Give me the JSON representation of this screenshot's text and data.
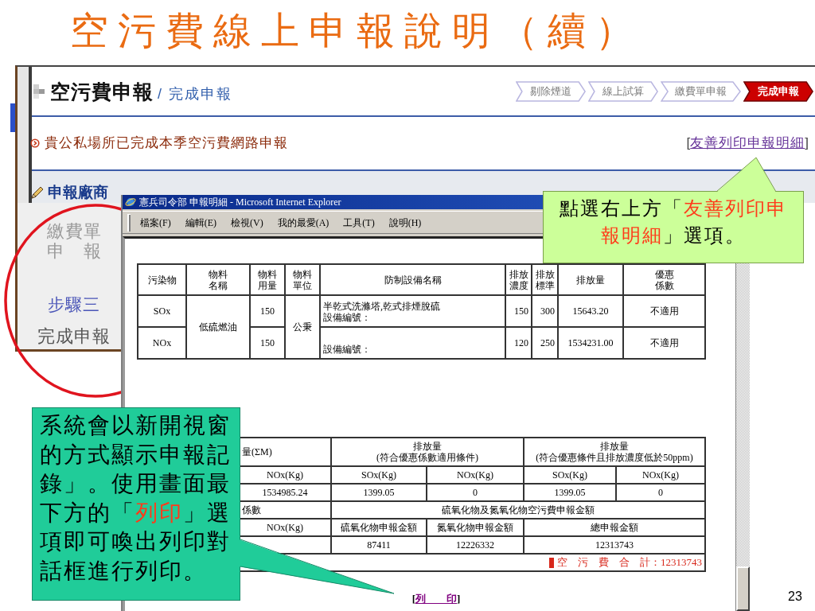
{
  "slide": {
    "title": "空污費線上申報說明（續）",
    "page_number": "23"
  },
  "web_page": {
    "title": "空污費申報",
    "subtitle": "/ 完成申報",
    "steps": [
      {
        "label": "剔除煙道",
        "selected": false
      },
      {
        "label": "線上試算",
        "selected": false
      },
      {
        "label": "繳費單申報",
        "selected": false
      },
      {
        "label": "完成申報",
        "selected": true
      }
    ],
    "notice": "貴公私場所已完成本季空污費網路申報",
    "print_link": {
      "open": "[",
      "label": "友善列印申報明細",
      "close": "]"
    },
    "section_label": "申報廠商",
    "sidebar": [
      {
        "kind": "label",
        "text": "繳費單",
        "dimmed": true
      },
      {
        "kind": "label",
        "text": "申　報",
        "dimmed": true
      },
      {
        "kind": "step",
        "text": "步驟三"
      },
      {
        "kind": "label",
        "text": "完成申報",
        "dimmed": false
      }
    ]
  },
  "browser_window": {
    "title": "憲兵司令部 申報明細 - Microsoft Internet Explorer",
    "menu": [
      "檔案(F)",
      "編輯(E)",
      "檢視(V)",
      "我的最愛(A)",
      "工具(T)",
      "說明(H)"
    ],
    "emissions_table": {
      "columns": [
        {
          "lines": [
            "污染物"
          ]
        },
        {
          "lines": [
            "物料",
            "名稱"
          ]
        },
        {
          "lines": [
            "物料",
            "用量"
          ]
        },
        {
          "lines": [
            "物料",
            "單位"
          ]
        },
        {
          "lines": [
            "防制設備名稱"
          ]
        },
        {
          "lines": [
            "排放",
            "濃度"
          ]
        },
        {
          "lines": [
            "排放",
            "標準"
          ]
        },
        {
          "lines": [
            "排放量"
          ]
        },
        {
          "lines": [
            "優惠",
            "係數"
          ]
        }
      ],
      "rows": [
        [
          {
            "lines": [
              "SOx"
            ]
          },
          {
            "lines": [
              "低硫燃油"
            ],
            "rowspan": 2
          },
          {
            "lines": [
              "150"
            ]
          },
          {
            "lines": [
              "公秉"
            ],
            "rowspan": 2
          },
          {
            "lines": [
              "半乾式洗滌塔,乾式排煙脫硫",
              "設備編號："
            ]
          },
          {
            "lines": [
              "150"
            ]
          },
          {
            "lines": [
              "300"
            ]
          },
          {
            "lines": [
              "15643.20"
            ]
          },
          {
            "lines": [
              "不適用"
            ]
          }
        ],
        [
          {
            "lines": [
              "NOx"
            ]
          },
          {
            "lines": [
              "150"
            ]
          },
          {
            "lines": [
              "設備編號："
            ]
          },
          {
            "lines": [
              "120"
            ]
          },
          {
            "lines": [
              "250"
            ]
          },
          {
            "lines": [
              "1534231.00"
            ]
          },
          {
            "lines": [
              "不適用"
            ]
          }
        ]
      ]
    },
    "totals_table": {
      "rows": [
        {
          "kind": "group",
          "cells": [
            {
              "lines": [
                "量(ΣM)"
              ]
            },
            {
              "lines": [
                "排放量",
                "(符合優惠係數適用條件)"
              ],
              "colspan": 2
            },
            {
              "lines": [
                "排放量",
                "(符合優惠條件且排放濃度低於50ppm)"
              ],
              "colspan": 2
            }
          ]
        },
        {
          "kind": "columns",
          "cells": [
            {
              "lines": [
                "NOx(Kg)"
              ]
            },
            {
              "lines": [
                "SOx(Kg)"
              ]
            },
            {
              "lines": [
                "NOx(Kg)"
              ]
            },
            {
              "lines": [
                "SOx(Kg)"
              ]
            },
            {
              "lines": [
                "NOx(Kg)"
              ]
            }
          ]
        },
        {
          "kind": "values",
          "cells": [
            {
              "lines": [
                "1534985.24"
              ]
            },
            {
              "lines": [
                "1399.05"
              ]
            },
            {
              "lines": [
                "0"
              ]
            },
            {
              "lines": [
                "1399.05"
              ]
            },
            {
              "lines": [
                "0"
              ]
            }
          ]
        },
        {
          "kind": "group",
          "cells": [
            {
              "lines": [
                "係數"
              ]
            },
            {
              "lines": [
                "硫氧化物及氮氧化物空污費申報金額"
              ],
              "colspan": 4
            }
          ]
        },
        {
          "kind": "columns",
          "cells": [
            {
              "lines": [
                "NOx(Kg)"
              ]
            },
            {
              "lines": [
                "硫氧化物申報金額"
              ]
            },
            {
              "lines": [
                "氮氧化物申報金額"
              ]
            },
            {
              "lines": [
                "總申報金額"
              ],
              "colspan": 2
            }
          ]
        },
        {
          "kind": "values",
          "cells": [
            {},
            {
              "lines": [
                "87411"
              ]
            },
            {
              "lines": [
                "12226332"
              ]
            },
            {
              "lines": [
                "12313743"
              ],
              "colspan": 2
            }
          ]
        }
      ],
      "total": "空　污　費　合　計：12313743"
    },
    "print_button": {
      "open": "[",
      "label": "列　　印",
      "close": "]"
    }
  },
  "callouts": [
    {
      "kind": "lower-left",
      "segments": [
        {
          "text": "系統會以新開視窗的方式顯示申報記錄」。使用畫面最下方的「",
          "highlighted": false
        },
        {
          "text": "列印",
          "highlighted": true
        },
        {
          "text": "」選項即可喚出列印對話框進行列印。",
          "highlighted": false
        }
      ]
    },
    {
      "kind": "upper-right",
      "segments": [
        {
          "text": "點選右上方「",
          "highlighted": false
        },
        {
          "text": "友善列印申報明細",
          "highlighted": true
        },
        {
          "text": "」選項。",
          "highlighted": false
        }
      ]
    }
  ]
}
